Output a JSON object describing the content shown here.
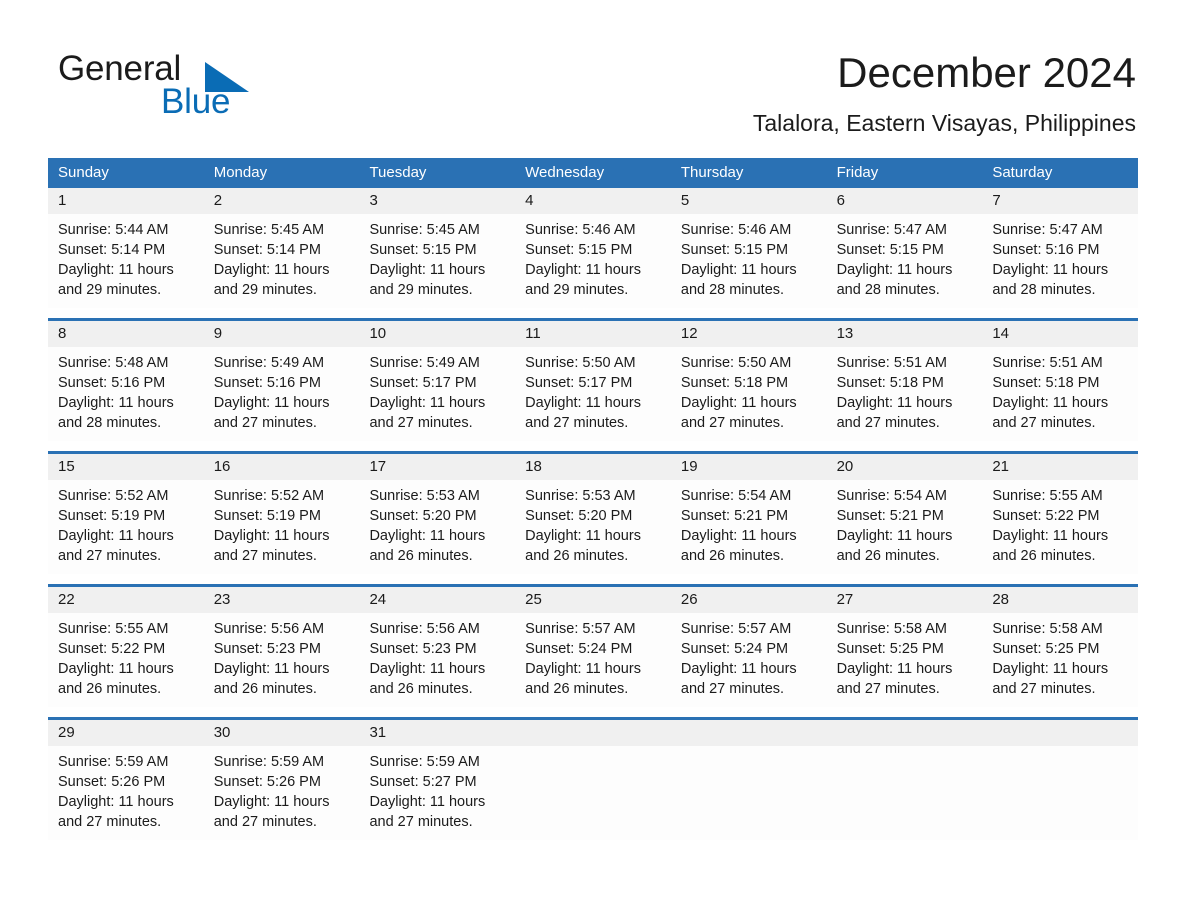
{
  "brand": {
    "word_one": "General",
    "word_two": "Blue",
    "triangle_icon": "triangle-icon",
    "accent_color": "#0a6cb5"
  },
  "header": {
    "month_title": "December 2024",
    "location": "Talalora, Eastern Visayas, Philippines"
  },
  "calendar": {
    "header_bg": "#2a71b4",
    "daterow_bg": "#f0f0f0",
    "weekday_headers": [
      "Sunday",
      "Monday",
      "Tuesday",
      "Wednesday",
      "Thursday",
      "Friday",
      "Saturday"
    ],
    "weeks": [
      {
        "days": [
          {
            "date": "1",
            "sunrise": "Sunrise: 5:44 AM",
            "sunset": "Sunset: 5:14 PM",
            "daylight_line1": "Daylight: 11 hours",
            "daylight_line2": "and 29 minutes."
          },
          {
            "date": "2",
            "sunrise": "Sunrise: 5:45 AM",
            "sunset": "Sunset: 5:14 PM",
            "daylight_line1": "Daylight: 11 hours",
            "daylight_line2": "and 29 minutes."
          },
          {
            "date": "3",
            "sunrise": "Sunrise: 5:45 AM",
            "sunset": "Sunset: 5:15 PM",
            "daylight_line1": "Daylight: 11 hours",
            "daylight_line2": "and 29 minutes."
          },
          {
            "date": "4",
            "sunrise": "Sunrise: 5:46 AM",
            "sunset": "Sunset: 5:15 PM",
            "daylight_line1": "Daylight: 11 hours",
            "daylight_line2": "and 29 minutes."
          },
          {
            "date": "5",
            "sunrise": "Sunrise: 5:46 AM",
            "sunset": "Sunset: 5:15 PM",
            "daylight_line1": "Daylight: 11 hours",
            "daylight_line2": "and 28 minutes."
          },
          {
            "date": "6",
            "sunrise": "Sunrise: 5:47 AM",
            "sunset": "Sunset: 5:15 PM",
            "daylight_line1": "Daylight: 11 hours",
            "daylight_line2": "and 28 minutes."
          },
          {
            "date": "7",
            "sunrise": "Sunrise: 5:47 AM",
            "sunset": "Sunset: 5:16 PM",
            "daylight_line1": "Daylight: 11 hours",
            "daylight_line2": "and 28 minutes."
          }
        ]
      },
      {
        "days": [
          {
            "date": "8",
            "sunrise": "Sunrise: 5:48 AM",
            "sunset": "Sunset: 5:16 PM",
            "daylight_line1": "Daylight: 11 hours",
            "daylight_line2": "and 28 minutes."
          },
          {
            "date": "9",
            "sunrise": "Sunrise: 5:49 AM",
            "sunset": "Sunset: 5:16 PM",
            "daylight_line1": "Daylight: 11 hours",
            "daylight_line2": "and 27 minutes."
          },
          {
            "date": "10",
            "sunrise": "Sunrise: 5:49 AM",
            "sunset": "Sunset: 5:17 PM",
            "daylight_line1": "Daylight: 11 hours",
            "daylight_line2": "and 27 minutes."
          },
          {
            "date": "11",
            "sunrise": "Sunrise: 5:50 AM",
            "sunset": "Sunset: 5:17 PM",
            "daylight_line1": "Daylight: 11 hours",
            "daylight_line2": "and 27 minutes."
          },
          {
            "date": "12",
            "sunrise": "Sunrise: 5:50 AM",
            "sunset": "Sunset: 5:18 PM",
            "daylight_line1": "Daylight: 11 hours",
            "daylight_line2": "and 27 minutes."
          },
          {
            "date": "13",
            "sunrise": "Sunrise: 5:51 AM",
            "sunset": "Sunset: 5:18 PM",
            "daylight_line1": "Daylight: 11 hours",
            "daylight_line2": "and 27 minutes."
          },
          {
            "date": "14",
            "sunrise": "Sunrise: 5:51 AM",
            "sunset": "Sunset: 5:18 PM",
            "daylight_line1": "Daylight: 11 hours",
            "daylight_line2": "and 27 minutes."
          }
        ]
      },
      {
        "days": [
          {
            "date": "15",
            "sunrise": "Sunrise: 5:52 AM",
            "sunset": "Sunset: 5:19 PM",
            "daylight_line1": "Daylight: 11 hours",
            "daylight_line2": "and 27 minutes."
          },
          {
            "date": "16",
            "sunrise": "Sunrise: 5:52 AM",
            "sunset": "Sunset: 5:19 PM",
            "daylight_line1": "Daylight: 11 hours",
            "daylight_line2": "and 27 minutes."
          },
          {
            "date": "17",
            "sunrise": "Sunrise: 5:53 AM",
            "sunset": "Sunset: 5:20 PM",
            "daylight_line1": "Daylight: 11 hours",
            "daylight_line2": "and 26 minutes."
          },
          {
            "date": "18",
            "sunrise": "Sunrise: 5:53 AM",
            "sunset": "Sunset: 5:20 PM",
            "daylight_line1": "Daylight: 11 hours",
            "daylight_line2": "and 26 minutes."
          },
          {
            "date": "19",
            "sunrise": "Sunrise: 5:54 AM",
            "sunset": "Sunset: 5:21 PM",
            "daylight_line1": "Daylight: 11 hours",
            "daylight_line2": "and 26 minutes."
          },
          {
            "date": "20",
            "sunrise": "Sunrise: 5:54 AM",
            "sunset": "Sunset: 5:21 PM",
            "daylight_line1": "Daylight: 11 hours",
            "daylight_line2": "and 26 minutes."
          },
          {
            "date": "21",
            "sunrise": "Sunrise: 5:55 AM",
            "sunset": "Sunset: 5:22 PM",
            "daylight_line1": "Daylight: 11 hours",
            "daylight_line2": "and 26 minutes."
          }
        ]
      },
      {
        "days": [
          {
            "date": "22",
            "sunrise": "Sunrise: 5:55 AM",
            "sunset": "Sunset: 5:22 PM",
            "daylight_line1": "Daylight: 11 hours",
            "daylight_line2": "and 26 minutes."
          },
          {
            "date": "23",
            "sunrise": "Sunrise: 5:56 AM",
            "sunset": "Sunset: 5:23 PM",
            "daylight_line1": "Daylight: 11 hours",
            "daylight_line2": "and 26 minutes."
          },
          {
            "date": "24",
            "sunrise": "Sunrise: 5:56 AM",
            "sunset": "Sunset: 5:23 PM",
            "daylight_line1": "Daylight: 11 hours",
            "daylight_line2": "and 26 minutes."
          },
          {
            "date": "25",
            "sunrise": "Sunrise: 5:57 AM",
            "sunset": "Sunset: 5:24 PM",
            "daylight_line1": "Daylight: 11 hours",
            "daylight_line2": "and 26 minutes."
          },
          {
            "date": "26",
            "sunrise": "Sunrise: 5:57 AM",
            "sunset": "Sunset: 5:24 PM",
            "daylight_line1": "Daylight: 11 hours",
            "daylight_line2": "and 27 minutes."
          },
          {
            "date": "27",
            "sunrise": "Sunrise: 5:58 AM",
            "sunset": "Sunset: 5:25 PM",
            "daylight_line1": "Daylight: 11 hours",
            "daylight_line2": "and 27 minutes."
          },
          {
            "date": "28",
            "sunrise": "Sunrise: 5:58 AM",
            "sunset": "Sunset: 5:25 PM",
            "daylight_line1": "Daylight: 11 hours",
            "daylight_line2": "and 27 minutes."
          }
        ]
      },
      {
        "days": [
          {
            "date": "29",
            "sunrise": "Sunrise: 5:59 AM",
            "sunset": "Sunset: 5:26 PM",
            "daylight_line1": "Daylight: 11 hours",
            "daylight_line2": "and 27 minutes."
          },
          {
            "date": "30",
            "sunrise": "Sunrise: 5:59 AM",
            "sunset": "Sunset: 5:26 PM",
            "daylight_line1": "Daylight: 11 hours",
            "daylight_line2": "and 27 minutes."
          },
          {
            "date": "31",
            "sunrise": "Sunrise: 5:59 AM",
            "sunset": "Sunset: 5:27 PM",
            "daylight_line1": "Daylight: 11 hours",
            "daylight_line2": "and 27 minutes."
          },
          {
            "date": "",
            "sunrise": "",
            "sunset": "",
            "daylight_line1": "",
            "daylight_line2": ""
          },
          {
            "date": "",
            "sunrise": "",
            "sunset": "",
            "daylight_line1": "",
            "daylight_line2": ""
          },
          {
            "date": "",
            "sunrise": "",
            "sunset": "",
            "daylight_line1": "",
            "daylight_line2": ""
          },
          {
            "date": "",
            "sunrise": "",
            "sunset": "",
            "daylight_line1": "",
            "daylight_line2": ""
          }
        ]
      }
    ]
  }
}
